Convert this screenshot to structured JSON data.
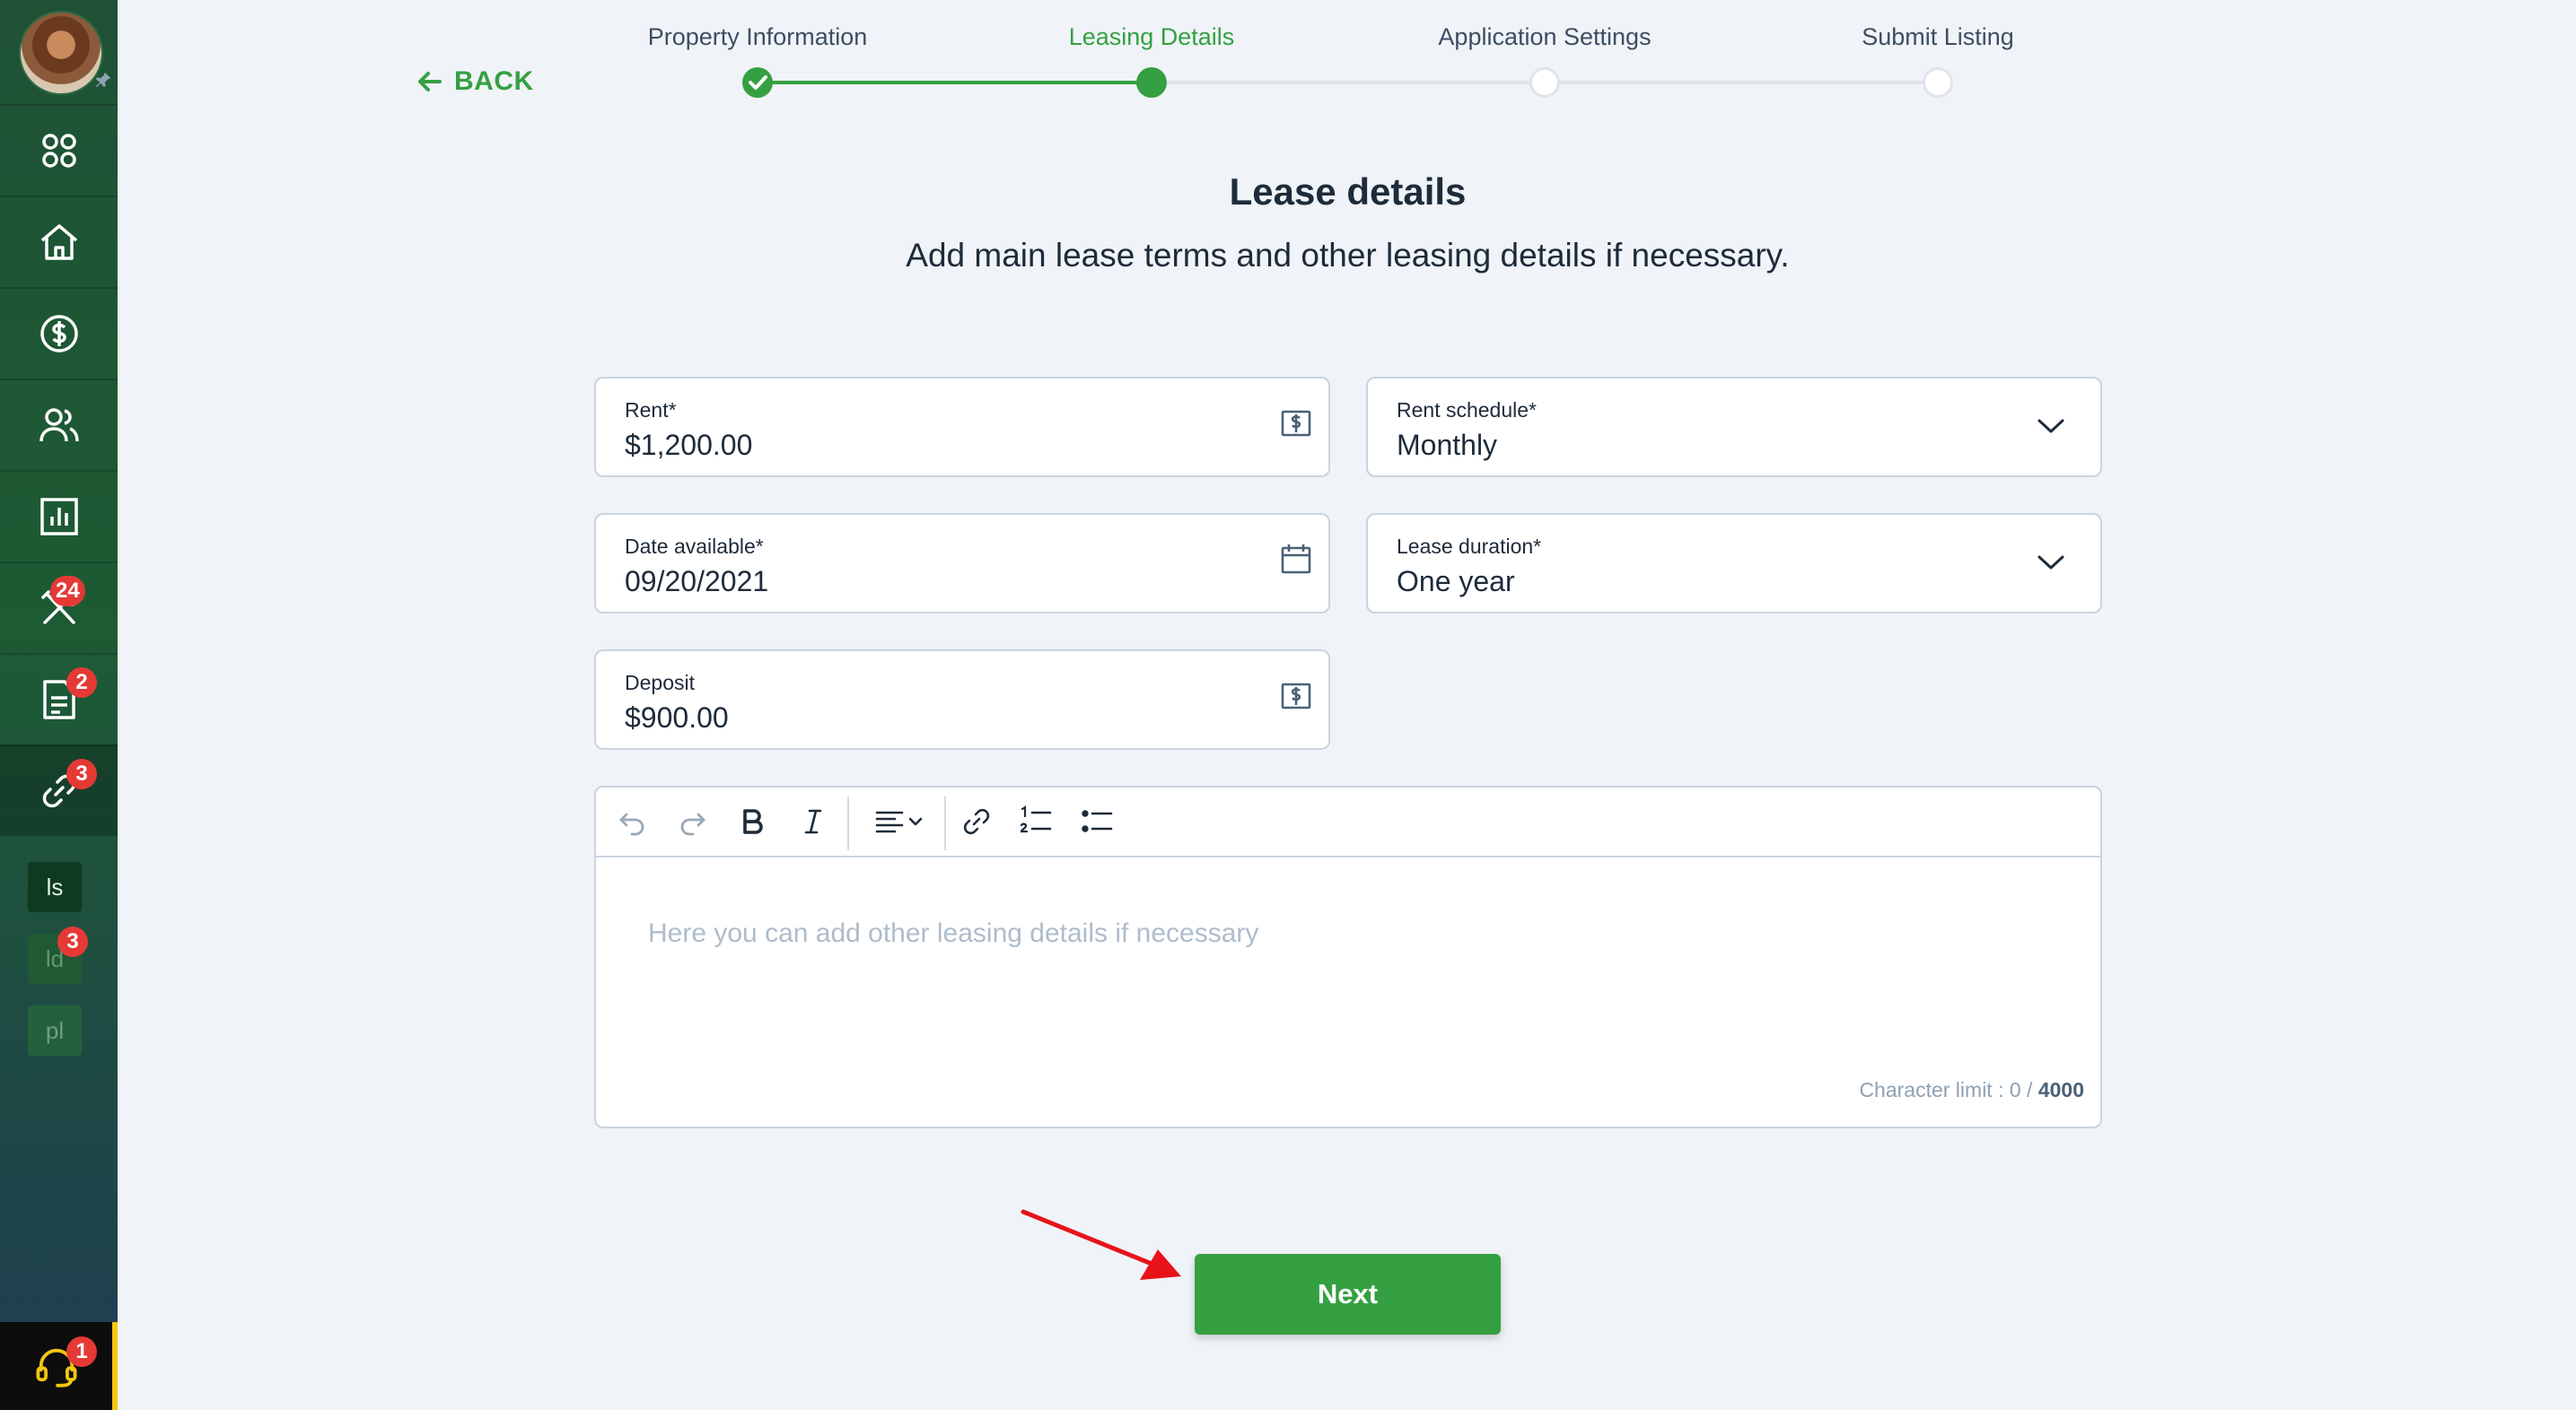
{
  "sidebar": {
    "badges": {
      "maintenance": "24",
      "documents": "2",
      "listings": "3",
      "ld": "3",
      "support": "1"
    },
    "mini_items": [
      {
        "label": "ls"
      },
      {
        "label": "ld"
      },
      {
        "label": "pl"
      }
    ]
  },
  "header": {
    "back_label": "BACK",
    "steps": [
      {
        "label": "Property Information",
        "status": "done"
      },
      {
        "label": "Leasing Details",
        "status": "current"
      },
      {
        "label": "Application Settings",
        "status": "todo"
      },
      {
        "label": "Submit Listing",
        "status": "todo"
      }
    ]
  },
  "main": {
    "title": "Lease details",
    "subtitle": "Add main lease terms and other leasing details if necessary.",
    "fields": {
      "rent": {
        "label": "Rent*",
        "value": "$1,200.00"
      },
      "rent_schedule": {
        "label": "Rent schedule*",
        "value": "Monthly"
      },
      "date_available": {
        "label": "Date available*",
        "value": "09/20/2021"
      },
      "lease_duration": {
        "label": "Lease duration*",
        "value": "One year"
      },
      "deposit": {
        "label": "Deposit",
        "value": "$900.00"
      }
    },
    "editor": {
      "placeholder": "Here you can add other leasing details if necessary",
      "char_limit_label": "Character limit : 0 / ",
      "char_limit_max": "4000"
    },
    "next_label": "Next"
  },
  "colors": {
    "accent": "#35a041",
    "badge": "#e53935",
    "annotation_arrow": "#e8121b"
  }
}
